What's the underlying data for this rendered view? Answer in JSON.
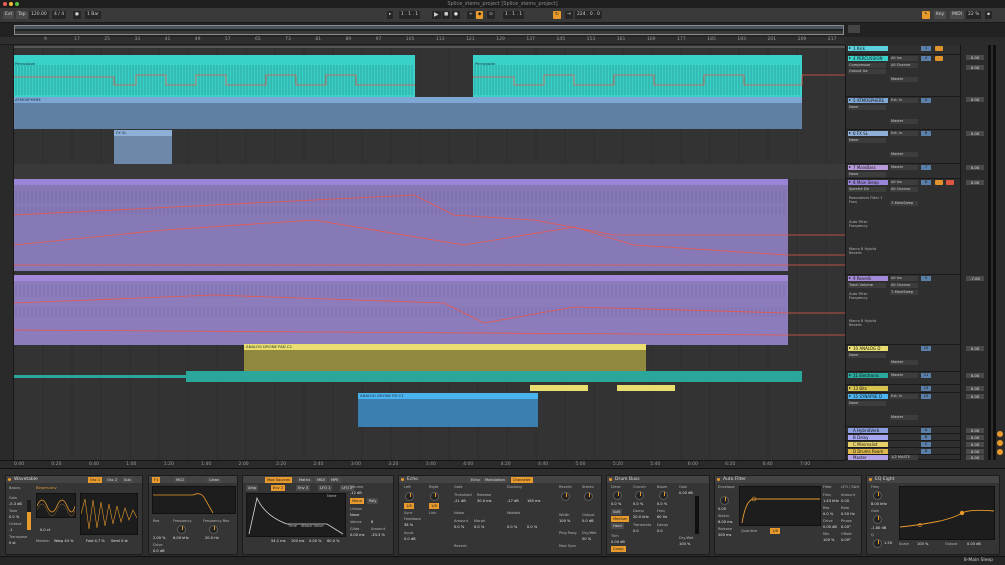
{
  "window": {
    "title": "Splice_stems_project  [Splice_stems_project]"
  },
  "colors": {
    "accent": "#e89a2c",
    "cyan": "#3ad1c8",
    "blue": "#7fa7d6",
    "purple": "#9a84d8",
    "yellow": "#e9de6f",
    "teal": "#2aa69b",
    "skyblue": "#4bb3f0",
    "automation": "#e8584a"
  },
  "transport": {
    "ext": "Ext",
    "tap": "Tap",
    "tempo": "120.00",
    "signature": "4 / 4",
    "quantize": "1 Bar",
    "position": "1 . 1 . 1",
    "loop_start": "1 . 1 . 1",
    "loop_length": "224 . 0 . 0",
    "key": "Key",
    "midi": "MIDI",
    "cpu": "22 %"
  },
  "ruler": {
    "ticks": [
      "9",
      "17",
      "25",
      "33",
      "41",
      "49",
      "57",
      "65",
      "73",
      "81",
      "89",
      "97",
      "105",
      "113",
      "121",
      "129",
      "137",
      "145",
      "153",
      "161",
      "169",
      "177",
      "185",
      "193",
      "201",
      "209",
      "217",
      "225"
    ]
  },
  "timebar": {
    "ticks": [
      "0:00",
      "0:20",
      "0:40",
      "1:00",
      "1:20",
      "1:40",
      "2:00",
      "2:20",
      "2:40",
      "3:00",
      "3:20",
      "3:40",
      "4:00",
      "4:20",
      "4:40",
      "5:00",
      "5:20",
      "5:40",
      "6:00",
      "6:20",
      "6:40",
      "7:00"
    ]
  },
  "clips": {
    "percussion_a": "Percussion",
    "percussion_b": "Percussion",
    "atmosphere": "ATMOSPHERE",
    "fx": "FX SL",
    "analog_drone": "ANALOG DRONE PAD C1",
    "analog_drone_2": "ANALOG DRONE PD C1"
  },
  "tracks": [
    {
      "name": "1 Kick",
      "color": "#5ad1dc",
      "vol": "0.00"
    },
    {
      "name": "4 PERCUSSION",
      "color": "#3ad1c8",
      "vol": "0.00",
      "device": "Compressor",
      "param": "Output Ga",
      "input": "All Ins",
      "channel": "All Channe",
      "monitor": "Master"
    },
    {
      "name": "5 ATMOSPHERE",
      "color": "#7fa7d6",
      "vol": "0.00",
      "device": "None",
      "input": "Ext. In",
      "monitor": "Master"
    },
    {
      "name": "6 FX SL",
      "color": "#8eb0d8",
      "vol": "0.00",
      "device": "None",
      "input": "Ext. In",
      "monitor": "Master"
    },
    {
      "name": "7 MainBass",
      "color": "#b69ad8",
      "vol": "0.00",
      "device": "None",
      "monitor": "Master"
    },
    {
      "name": "8 Main Sleep",
      "color": "#9a84d8",
      "vol": "0.00",
      "device": "Spectre Dri",
      "input": "All Ins",
      "channel": "All Channe",
      "monitor": "7-MainSleep",
      "lanes": [
        "Resonators Filter 1 Freq",
        "Auto Filter Frequency",
        "Macro 8 Hybrid Reverb"
      ]
    },
    {
      "name": "9 Reverb",
      "color": "#a28ad8",
      "vol": "-7.00",
      "device": "Track Volume",
      "input": "All Ins",
      "channel": "All Channe",
      "monitor": "7-MainSleep",
      "lanes": [
        "Auto Filter Frequency",
        "Macro 8 Hybrid Reverb"
      ]
    },
    {
      "name": "10 ANALOG D",
      "color": "#e9de6f",
      "vol": "0.00",
      "device": "None",
      "monitor": "Master"
    },
    {
      "name": "11 Electronic",
      "color": "#2aa69b",
      "vol": "0.00",
      "monitor": "Master"
    },
    {
      "name": "13 Bits",
      "color": "#d7c44f",
      "vol": "0.00"
    },
    {
      "name": "15 SYNAPSE D",
      "color": "#4bb3f0",
      "vol": "0.00",
      "device": "None",
      "input": "Ext. In",
      "monitor": "Master"
    },
    {
      "name": "A HybridVerb",
      "color": "#8a9ee0",
      "vol": "0.00"
    },
    {
      "name": "B Delay",
      "color": "#a7a6f0",
      "vol": "0.00"
    },
    {
      "name": "C Minimalist",
      "color": "#e5d06a",
      "vol": "0.00"
    },
    {
      "name": "D Drums Room",
      "color": "#e0b84a",
      "vol": "0.00"
    },
    {
      "name": "Master",
      "color": "#b2a3e8",
      "vol": "0.00",
      "monitor": "1/2 MASTE"
    }
  ],
  "devices": {
    "wavetable": {
      "title": "Wavetable",
      "osc1": "Osc 1",
      "osc2": "Osc 2",
      "sub": "Sub",
      "category": "Basics",
      "wave": "Binorm.env",
      "position_label": "Modern",
      "position_val": "Warp 44 %",
      "fold": "Fold 4.7 %",
      "semi": "Semi 0 st",
      "detune": "0.0 ct",
      "gain": "Gain",
      "gain_val": "-5.3 dB",
      "tone": "Tone",
      "tone_val": "0.0 %",
      "octave": "Octave",
      "octave_val": "-1",
      "transpose": "Transpose",
      "transpose_val": "0 st"
    },
    "filter": {
      "f1": "F1",
      "mg2": "MG2",
      "clean": "Clean",
      "res": "Res",
      "freq": "Frequency",
      "freq_val": "6.00 kHz",
      "res_val": "2.00 %",
      "freq2": "Frequency Res",
      "freq2_val": "20.0 Hz",
      "drive": "Drive",
      "drive_val": "0.0 dB"
    },
    "mod": {
      "tabs": [
        "Mod Sources",
        "Matrix",
        "MIDI",
        "MPE"
      ],
      "env1": "Env 1",
      "env2": "Env 2",
      "env3": "Env 3",
      "lfo1": "LFO 1",
      "lfo2": "LFO 2",
      "time": "Time",
      "attack": "Attack Value",
      "attack_val": "54.1 ms",
      "decay": "100 ms",
      "sustain": "0.00 %",
      "release": "60.0 %",
      "amp": "Amp",
      "none": "None",
      "mono": "Mono",
      "poly": "Poly",
      "voices": "Voices",
      "voices_val": "8",
      "glide": "Glide",
      "glide_val": "0.00 ms",
      "amount": "Amount",
      "amount_val": "-33.3 %",
      "volume": "Volume",
      "volume_val": "-12 dB",
      "unison": "Unison",
      "unison_val": "None"
    },
    "echo": {
      "title": "Echo",
      "tabs": [
        "Echo",
        "Modulation",
        "Character"
      ],
      "left": "Left",
      "right": "Right",
      "left_val": "1/8",
      "right_val": "1/8",
      "sync": "Sync",
      "link": "Link",
      "feedback": "Feedback",
      "fb_val": "38 %",
      "input": "Input",
      "input_val": "0.0 dB",
      "gate": "Gate",
      "ducking": "Ducking",
      "threshold": "Threshold",
      "release": "Release",
      "thr_val": "-21 dB",
      "rel_val": "30.0 ms",
      "thr2_val": "-27 dB",
      "rel2_val": "165 ms",
      "noise": "Noise",
      "wobble": "Wobble",
      "amount": "Amount",
      "morph": "Morph",
      "amt_val": "0.0 %",
      "morph_val": "0.0 %",
      "amt2_val": "0.0 %",
      "morph2_val": "0.0 %",
      "reverb": "Reverb",
      "width": "Width",
      "stereo": "Stereo",
      "output": "Output",
      "dry_wet": "Dry/Wet",
      "wet_val": "50 %",
      "ping": "Ping Pong",
      "width_val": "100 %",
      "out_val": "0.0 dB",
      "res": "Reverb",
      "mod_sync": "Mod Sync"
    },
    "drum_buss": {
      "title": "Drum Buss",
      "drive": "Drive",
      "crunch": "Crunch",
      "boom": "Boom",
      "trim": "Trim",
      "damp": "Damp",
      "freq": "Freq",
      "transients": "Transients",
      "decay": "Decay",
      "drive_val": "0.0 %",
      "crunch_val": "0.0 %",
      "boom_val": "0.0 %",
      "soft": "Soft",
      "medium": "Medium",
      "hard": "Hard",
      "damp_val": "20.0 kHz",
      "freq_val": "60 Hz",
      "decay_val": "0.0",
      "trans_val": "0.0",
      "comp": "Comp",
      "trim_val": "0.00 dB",
      "dry_wet": "Dry/Wet",
      "wet_val": "100 %",
      "gain": "Gain",
      "gain_val": "0.00 dB"
    },
    "auto_filter": {
      "title": "Auto Filter",
      "envelope": "Envelope",
      "lfo": "LFO / S&H",
      "filter": "Filter",
      "freq": "Freq",
      "res": "Res",
      "drive": "Drive",
      "attack": "Attack",
      "release": "Release",
      "amount": "Amount",
      "rate": "Rate",
      "phase": "Phase",
      "offset": "Offset",
      "freq_val": "1.43 kHz",
      "res_val": "0.0 %",
      "drive_val": "0.00 dB",
      "env_val": "0.00",
      "atk_val": "6.00 ms",
      "rel_val": "200 ms",
      "quant": "Quantize",
      "quant_val": "1/8",
      "rate_val": "0.50 Hz",
      "lfo_amt": "0.00",
      "phase_val": "0.00°",
      "offset_val": "0.00°",
      "mix": "Mix",
      "mix_val": "100 %"
    },
    "eq_eight": {
      "title": "EQ Eight",
      "freq": "Freq",
      "gain": "Gain",
      "q": "Q",
      "freq_val": "8.00 kHz",
      "gain_val": "-1.80 dB",
      "q_val": "1.50",
      "scale": "Scale",
      "scale_val": "100 %",
      "out": "Output",
      "out_val": "0.00 dB"
    }
  },
  "status": {
    "track": "8-Main Sleep"
  }
}
